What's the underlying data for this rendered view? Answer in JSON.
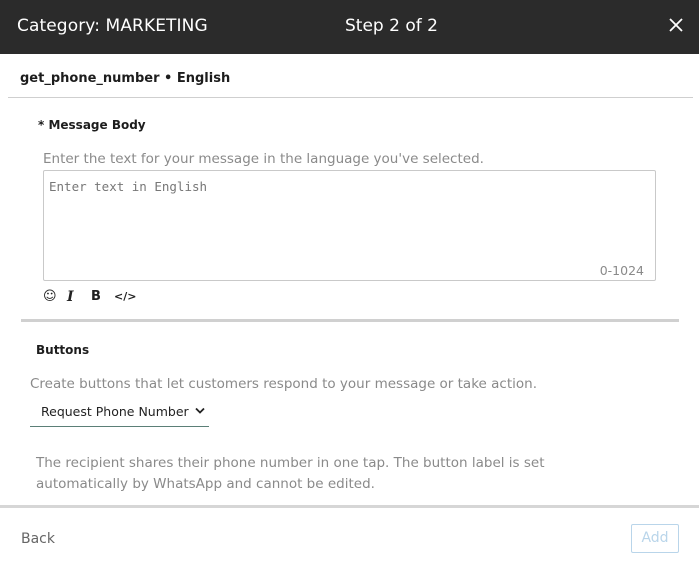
{
  "header": {
    "title": "Category: MARKETING",
    "step": "Step 2 of 2",
    "close_icon": "close-icon"
  },
  "template": {
    "name_line": "get_phone_number • English"
  },
  "message_body": {
    "label": "* Message Body",
    "help": "Enter the text for your message in the language you've selected.",
    "placeholder": "Enter text in English",
    "counter": "0-1024",
    "format_tools": {
      "emoji": "☺",
      "italic": "I",
      "bold": "B",
      "code": "</>"
    }
  },
  "buttons_section": {
    "label": "Buttons",
    "help": "Create buttons that let customers respond to your message or take action.",
    "selected_option": "Request Phone Number",
    "description": "The recipient shares their phone number in one tap. The button label is set automatically by WhatsApp and cannot be edited."
  },
  "footer": {
    "back_label": "Back",
    "add_label": "Add"
  },
  "colors": {
    "header_bg": "#2b2b2b",
    "add_button_disabled": "#b9d5ea",
    "select_underline": "#5b7f77"
  }
}
